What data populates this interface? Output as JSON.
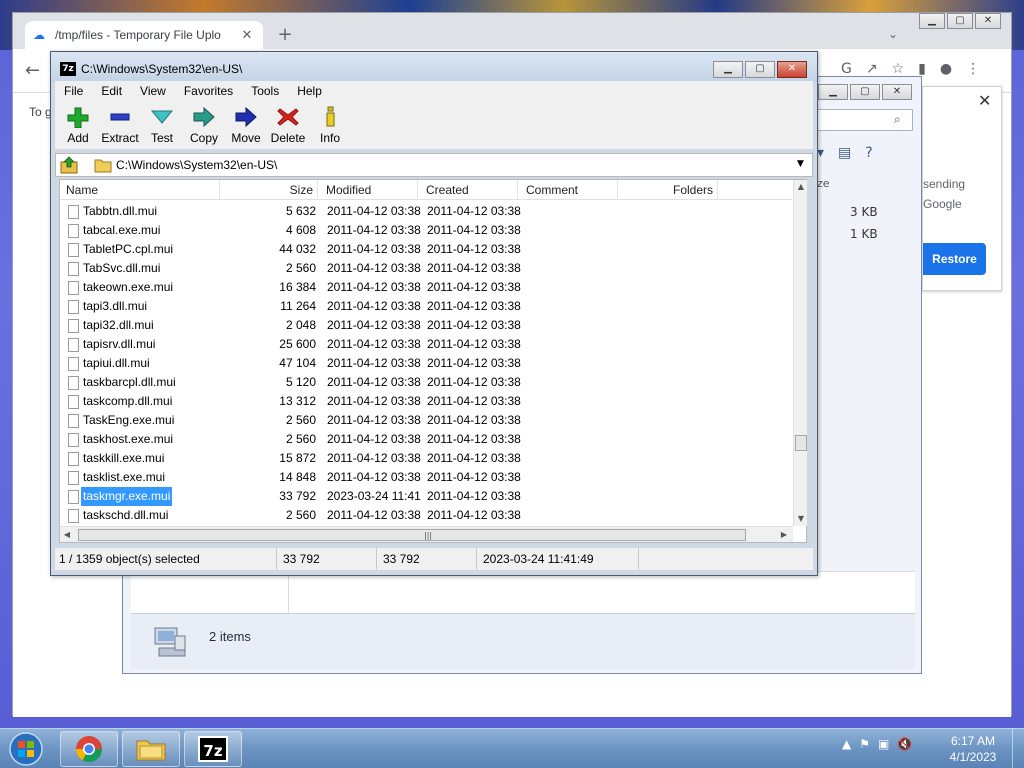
{
  "chrome": {
    "tab_title": "/tmp/files - Temporary File Uplo",
    "tab_close": "✕",
    "new_tab": "+",
    "page_partial_text": "To g",
    "back_icon": "←"
  },
  "download_bubble": {
    "line1": "sending",
    "line2": "Google",
    "restore_label": "Restore",
    "close": "✕"
  },
  "explorer": {
    "col_size": "ze",
    "sizes": [
      "3 KB",
      "1 KB"
    ],
    "status_text": "2 items"
  },
  "sevenzip": {
    "title": "C:\\Windows\\System32\\en-US\\",
    "title_icon_text": "7z",
    "menu": [
      "File",
      "Edit",
      "View",
      "Favorites",
      "Tools",
      "Help"
    ],
    "toolbar": {
      "add": "Add",
      "extract": "Extract",
      "test": "Test",
      "copy": "Copy",
      "move": "Move",
      "delete": "Delete",
      "info": "Info"
    },
    "path": "C:\\Windows\\System32\\en-US\\",
    "columns": {
      "name": "Name",
      "size": "Size",
      "modified": "Modified",
      "created": "Created",
      "comment": "Comment",
      "folders": "Folders"
    },
    "rows": [
      {
        "name": "Tabbtn.dll.mui",
        "size": "5 632",
        "modified": "2011-04-12 03:38",
        "created": "2011-04-12 03:38"
      },
      {
        "name": "tabcal.exe.mui",
        "size": "4 608",
        "modified": "2011-04-12 03:38",
        "created": "2011-04-12 03:38"
      },
      {
        "name": "TabletPC.cpl.mui",
        "size": "44 032",
        "modified": "2011-04-12 03:38",
        "created": "2011-04-12 03:38"
      },
      {
        "name": "TabSvc.dll.mui",
        "size": "2 560",
        "modified": "2011-04-12 03:38",
        "created": "2011-04-12 03:38"
      },
      {
        "name": "takeown.exe.mui",
        "size": "16 384",
        "modified": "2011-04-12 03:38",
        "created": "2011-04-12 03:38"
      },
      {
        "name": "tapi3.dll.mui",
        "size": "11 264",
        "modified": "2011-04-12 03:38",
        "created": "2011-04-12 03:38"
      },
      {
        "name": "tapi32.dll.mui",
        "size": "2 048",
        "modified": "2011-04-12 03:38",
        "created": "2011-04-12 03:38"
      },
      {
        "name": "tapisrv.dll.mui",
        "size": "25 600",
        "modified": "2011-04-12 03:38",
        "created": "2011-04-12 03:38"
      },
      {
        "name": "tapiui.dll.mui",
        "size": "47 104",
        "modified": "2011-04-12 03:38",
        "created": "2011-04-12 03:38"
      },
      {
        "name": "taskbarcpl.dll.mui",
        "size": "5 120",
        "modified": "2011-04-12 03:38",
        "created": "2011-04-12 03:38"
      },
      {
        "name": "taskcomp.dll.mui",
        "size": "13 312",
        "modified": "2011-04-12 03:38",
        "created": "2011-04-12 03:38"
      },
      {
        "name": "TaskEng.exe.mui",
        "size": "2 560",
        "modified": "2011-04-12 03:38",
        "created": "2011-04-12 03:38"
      },
      {
        "name": "taskhost.exe.mui",
        "size": "2 560",
        "modified": "2011-04-12 03:38",
        "created": "2011-04-12 03:38"
      },
      {
        "name": "taskkill.exe.mui",
        "size": "15 872",
        "modified": "2011-04-12 03:38",
        "created": "2011-04-12 03:38"
      },
      {
        "name": "tasklist.exe.mui",
        "size": "14 848",
        "modified": "2011-04-12 03:38",
        "created": "2011-04-12 03:38"
      },
      {
        "name": "taskmgr.exe.mui",
        "size": "33 792",
        "modified": "2023-03-24 11:41",
        "created": "2011-04-12 03:38",
        "selected": true
      },
      {
        "name": "taskschd.dll.mui",
        "size": "2 560",
        "modified": "2011-04-12 03:38",
        "created": "2011-04-12 03:38"
      }
    ],
    "status": {
      "selection": "1 / 1359 object(s) selected",
      "size": "33 792",
      "packed": "33 792",
      "modified": "2023-03-24 11:41:49"
    }
  },
  "taskbar": {
    "time": "6:17 AM",
    "date": "4/1/2023",
    "sevenzip_label": "7z"
  },
  "colors": {
    "selection": "#3399ff",
    "restore_button": "#1a73e8",
    "desktop": "#5a63d6"
  }
}
